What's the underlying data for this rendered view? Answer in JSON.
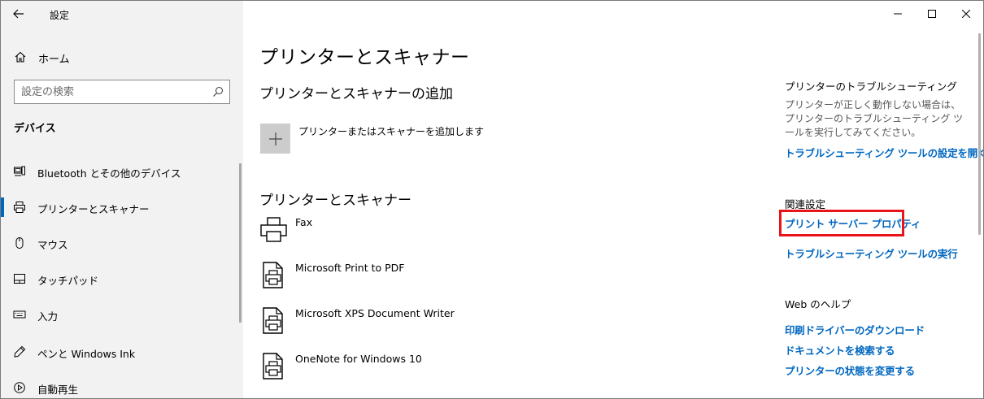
{
  "window": {
    "title": "設定"
  },
  "sidebar": {
    "home_label": "ホーム",
    "search_placeholder": "設定の検索",
    "section_label": "デバイス",
    "items": [
      {
        "label": "Bluetooth とその他のデバイス",
        "icon": "bluetooth-devices-icon"
      },
      {
        "label": "プリンターとスキャナー",
        "icon": "printer-icon",
        "active": true
      },
      {
        "label": "マウス",
        "icon": "mouse-icon"
      },
      {
        "label": "タッチパッド",
        "icon": "touchpad-icon"
      },
      {
        "label": "入力",
        "icon": "keyboard-icon"
      },
      {
        "label": "ペンと Windows Ink",
        "icon": "pen-icon"
      },
      {
        "label": "自動再生",
        "icon": "autoplay-icon"
      }
    ]
  },
  "main": {
    "page_title": "プリンターとスキャナー",
    "add_section_title": "プリンターとスキャナーの追加",
    "add_label": "プリンターまたはスキャナーを追加します",
    "list_title": "プリンターとスキャナー",
    "printers": [
      {
        "name": "Fax",
        "icon": "fax-printer-icon"
      },
      {
        "name": "Microsoft Print to PDF",
        "icon": "document-printer-icon"
      },
      {
        "name": "Microsoft XPS Document Writer",
        "icon": "document-printer-icon"
      },
      {
        "name": "OneNote for Windows 10",
        "icon": "document-printer-icon"
      }
    ]
  },
  "right": {
    "troubleshoot_heading": "プリンターのトラブルシューティング",
    "troubleshoot_text": "プリンターが正しく動作しない場合は、プリンターのトラブルシューティング ツールを実行してみてください。",
    "troubleshoot_link": "トラブルシューティング ツールの設定を開く",
    "related_heading": "関連設定",
    "related_links": [
      "プリント サーバー プロパティ",
      "トラブルシューティング ツールの実行"
    ],
    "web_help_heading": "Web のヘルプ",
    "web_help_links": [
      "印刷ドライバーのダウンロード",
      "ドキュメントを検索する",
      "プリンターの状態を変更する"
    ]
  },
  "colors": {
    "accent": "#0067c0",
    "highlight": "#e8141a",
    "sidebar_bg": "#f2f2f2"
  }
}
